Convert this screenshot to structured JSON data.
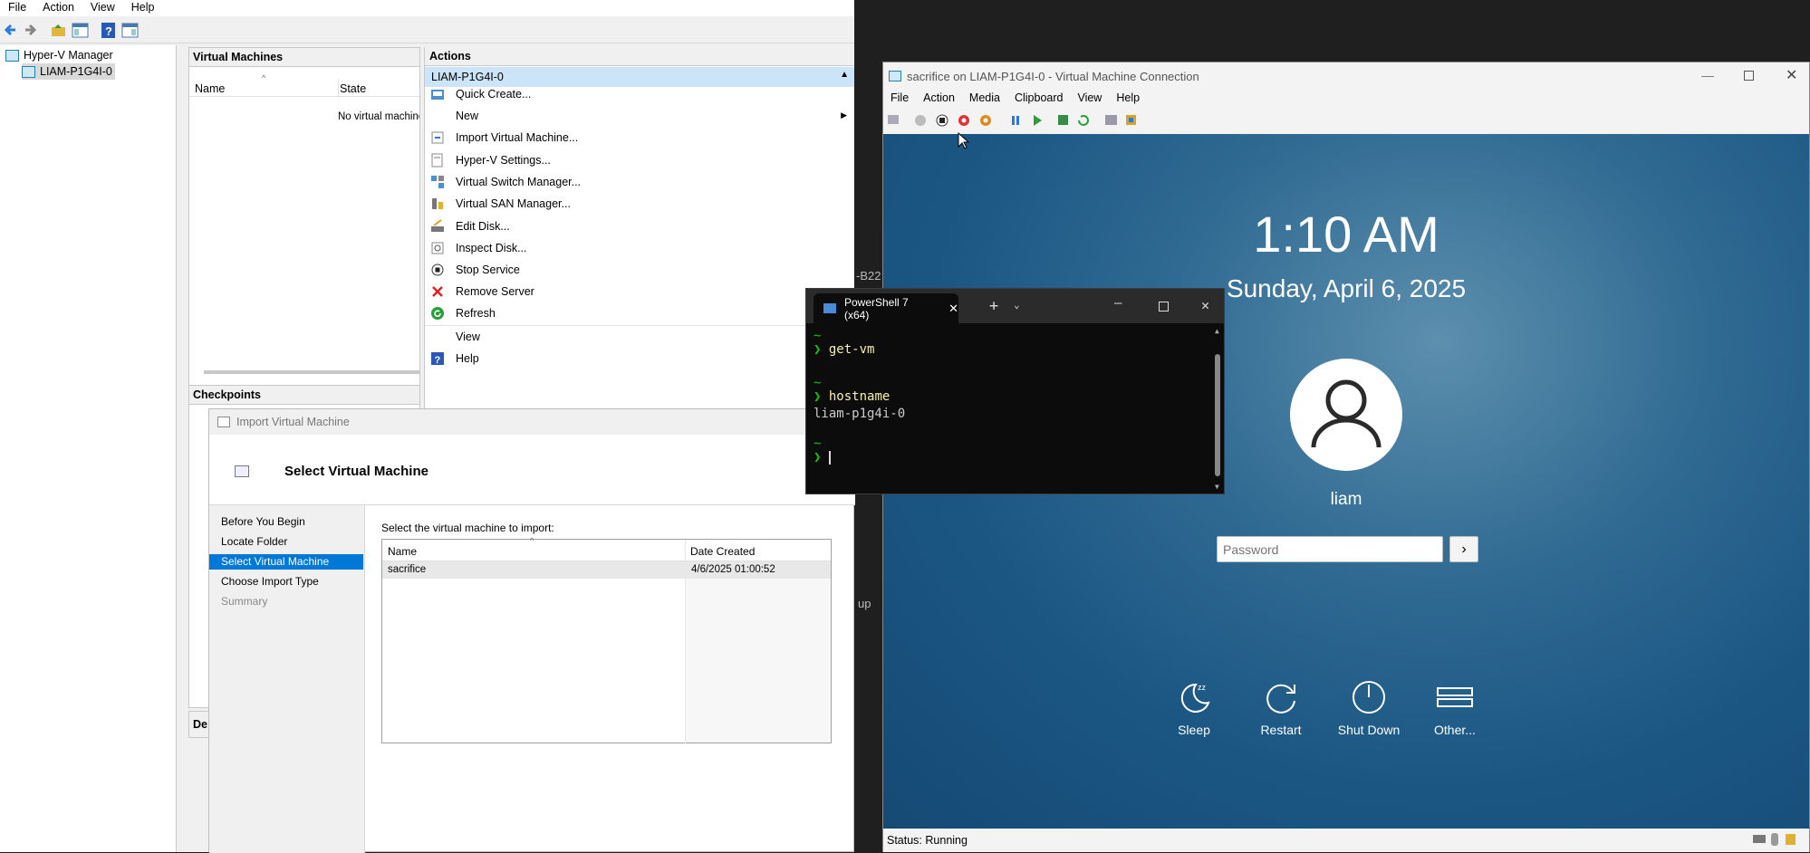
{
  "hyperv": {
    "menu": [
      "File",
      "Action",
      "View",
      "Help"
    ],
    "tree": {
      "root": "Hyper-V Manager",
      "server": "LIAM-P1G4I-0"
    },
    "vm_pane": {
      "title": "Virtual Machines",
      "columns": [
        "Name",
        "State"
      ],
      "empty_text": "No virtual machines",
      "checkpoints_title": "Checkpoints",
      "details_title_partial": "De"
    },
    "actions": {
      "title": "Actions",
      "section": "LIAM-P1G4I-0",
      "items": [
        {
          "label": "Quick Create...",
          "icon": "quick-create-icon"
        },
        {
          "label": "New",
          "icon": "none",
          "submenu": true
        },
        {
          "label": "Import Virtual Machine...",
          "icon": "import-icon"
        },
        {
          "label": "Hyper-V Settings...",
          "icon": "settings-icon"
        },
        {
          "label": "Virtual Switch Manager...",
          "icon": "switch-icon"
        },
        {
          "label": "Virtual SAN Manager...",
          "icon": "san-icon"
        },
        {
          "label": "Edit Disk...",
          "icon": "edit-disk-icon"
        },
        {
          "label": "Inspect Disk...",
          "icon": "inspect-disk-icon"
        },
        {
          "label": "Stop Service",
          "icon": "stop-icon"
        },
        {
          "label": "Remove Server",
          "icon": "remove-icon"
        },
        {
          "label": "Refresh",
          "icon": "refresh-icon"
        },
        {
          "label": "View",
          "icon": "none",
          "submenu": true
        },
        {
          "label": "Help",
          "icon": "help-icon"
        }
      ]
    }
  },
  "import_dialog": {
    "title": "Import Virtual Machine",
    "heading": "Select Virtual Machine",
    "nav": [
      "Before You Begin",
      "Locate Folder",
      "Select Virtual Machine",
      "Choose Import Type",
      "Summary"
    ],
    "selected_nav": "Select Virtual Machine",
    "prompt": "Select the virtual machine to import:",
    "columns": [
      "Name",
      "Date Created"
    ],
    "rows": [
      {
        "name": "sacrifice",
        "date": "4/6/2025 01:00:52"
      }
    ]
  },
  "terminal": {
    "tab_title": "PowerShell 7 (x64)",
    "lines": [
      {
        "text": "~",
        "color": "#16c60c"
      },
      {
        "prompt": "❯",
        "cmd": "get-vm"
      },
      {
        "text": "",
        "color": "#ccc"
      },
      {
        "text": "~",
        "color": "#16c60c"
      },
      {
        "prompt": "❯",
        "cmd": "hostname"
      },
      {
        "text": "liam-p1g4i-0",
        "color": "#cccccc"
      },
      {
        "text": "",
        "color": "#ccc"
      },
      {
        "text": "~",
        "color": "#16c60c"
      },
      {
        "prompt": "❯",
        "cmd": ""
      }
    ]
  },
  "background_fragments": {
    "b22": "-B22",
    "up": "up"
  },
  "vm_connection": {
    "title": "sacrifice on LIAM-P1G4I-0 - Virtual Machine Connection",
    "menu": [
      "File",
      "Action",
      "Media",
      "Clipboard",
      "View",
      "Help"
    ],
    "lock_screen": {
      "time": "1:10 AM",
      "date": "Sunday, April 6, 2025",
      "user": "liam",
      "password_placeholder": "Password",
      "power_options": [
        "Sleep",
        "Restart",
        "Shut Down",
        "Other..."
      ]
    },
    "status": "Status: Running"
  },
  "colors": {
    "selection": "#0078d7",
    "action_header": "#cce4f7",
    "prompt_green": "#16c60c",
    "cmd_yellow": "#f9f1a5"
  }
}
